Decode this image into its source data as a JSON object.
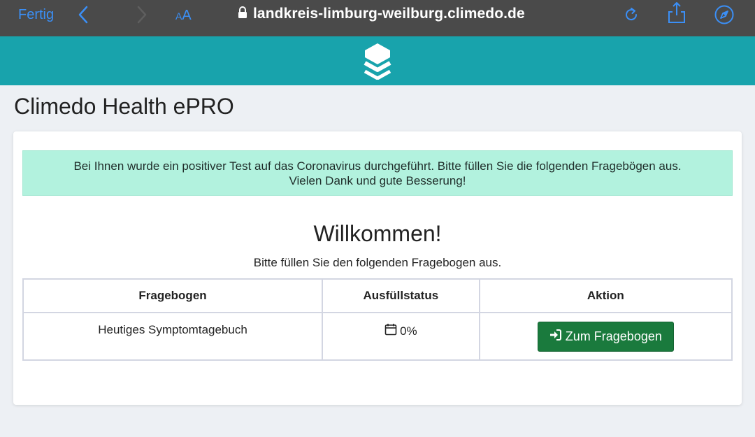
{
  "browser": {
    "done_label": "Fertig",
    "text_size_small": "A",
    "text_size_large": "A",
    "url": "landkreis-limburg-weilburg.climedo.de"
  },
  "page": {
    "title": "Climedo Health ePRO",
    "alert_line1": "Bei Ihnen wurde ein positiver Test auf das Coronavirus durchgeführt. Bitte füllen Sie die folgenden Fragebögen aus.",
    "alert_line2": "Vielen Dank und gute Besserung!",
    "welcome": "Willkommen!",
    "subtitle": "Bitte füllen Sie den folgenden Fragebogen aus."
  },
  "table": {
    "headers": [
      "Fragebogen",
      "Ausfüllstatus",
      "Aktion"
    ],
    "rows": [
      {
        "name": "Heutiges Symptomtagebuch",
        "status": "0%",
        "action": "Zum Fragebogen"
      }
    ]
  },
  "colors": {
    "chrome_bg": "#4a4a4a",
    "chrome_accent": "#3b8ff6",
    "brand_teal": "#18a3ac",
    "alert_bg": "#b2f2de",
    "button_green": "#1a7a3d"
  },
  "icons": [
    "back-icon",
    "forward-icon",
    "lock-icon",
    "reload-icon",
    "share-icon",
    "compass-icon",
    "layers-logo-icon",
    "calendar-icon",
    "sign-in-icon"
  ]
}
